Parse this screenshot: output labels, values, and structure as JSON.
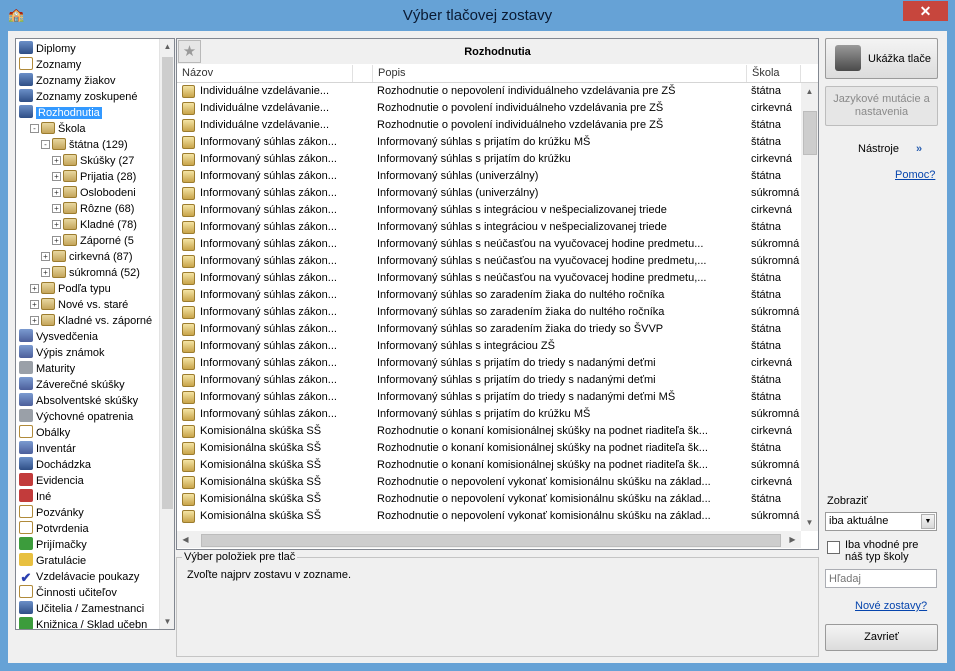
{
  "window": {
    "title": "Výber tlačovej zostavy",
    "close_glyph": "✕"
  },
  "tree": {
    "items": [
      {
        "label": "Diplomy",
        "indent": 0,
        "icon": "user"
      },
      {
        "label": "Zoznamy",
        "indent": 0,
        "icon": "doc"
      },
      {
        "label": "Zoznamy žiakov",
        "indent": 0,
        "icon": "user"
      },
      {
        "label": "Zoznamy zoskupené",
        "indent": 0,
        "icon": "user"
      },
      {
        "label": "Rozhodnutia",
        "indent": 0,
        "icon": "user",
        "selected": true
      },
      {
        "label": "Škola",
        "indent": 1,
        "icon": "folder",
        "pm": "-"
      },
      {
        "label": "štátna (129)",
        "indent": 2,
        "icon": "folder",
        "pm": "-"
      },
      {
        "label": "Skúšky (27",
        "indent": 3,
        "icon": "folder",
        "pm": "+"
      },
      {
        "label": "Prijatia (28)",
        "indent": 3,
        "icon": "folder",
        "pm": "+"
      },
      {
        "label": "Oslobodeni",
        "indent": 3,
        "icon": "folder",
        "pm": "+"
      },
      {
        "label": "Rôzne (68)",
        "indent": 3,
        "icon": "folder",
        "pm": "+"
      },
      {
        "label": "Kladné (78)",
        "indent": 3,
        "icon": "folder",
        "pm": "+"
      },
      {
        "label": "Záporné (5",
        "indent": 3,
        "icon": "folder",
        "pm": "+"
      },
      {
        "label": "cirkevná (87)",
        "indent": 2,
        "icon": "folder",
        "pm": "+"
      },
      {
        "label": "súkromná (52)",
        "indent": 2,
        "icon": "folder",
        "pm": "+"
      },
      {
        "label": "Podľa typu",
        "indent": 1,
        "icon": "folder",
        "pm": "+"
      },
      {
        "label": "Nové vs. staré",
        "indent": 1,
        "icon": "folder",
        "pm": "+"
      },
      {
        "label": "Kladné vs. záporné",
        "indent": 1,
        "icon": "folder",
        "pm": "+"
      },
      {
        "label": "Vysvedčenia",
        "indent": 0,
        "icon": "book"
      },
      {
        "label": "Výpis známok",
        "indent": 0,
        "icon": "book"
      },
      {
        "label": "Maturity",
        "indent": 0,
        "icon": "gray"
      },
      {
        "label": "Záverečné skúšky",
        "indent": 0,
        "icon": "book"
      },
      {
        "label": "Absolventské skúšky",
        "indent": 0,
        "icon": "book"
      },
      {
        "label": "Výchovné opatrenia",
        "indent": 0,
        "icon": "gray"
      },
      {
        "label": "Obálky",
        "indent": 0,
        "icon": "doc"
      },
      {
        "label": "Inventár",
        "indent": 0,
        "icon": "book"
      },
      {
        "label": "Dochádzka",
        "indent": 0,
        "icon": "user"
      },
      {
        "label": "Evidencia",
        "indent": 0,
        "icon": "red"
      },
      {
        "label": "Iné",
        "indent": 0,
        "icon": "red"
      },
      {
        "label": "Pozvánky",
        "indent": 0,
        "icon": "doc"
      },
      {
        "label": "Potvrdenia",
        "indent": 0,
        "icon": "doc"
      },
      {
        "label": "Prijímačky",
        "indent": 0,
        "icon": "grn"
      },
      {
        "label": "Gratulácie",
        "indent": 0,
        "icon": "yel"
      },
      {
        "label": "Vzdelávacie poukazy",
        "indent": 0,
        "icon": "check"
      },
      {
        "label": "Činnosti učiteľov",
        "indent": 0,
        "icon": "doc"
      },
      {
        "label": "Učitelia / Zamestnanci",
        "indent": 0,
        "icon": "user"
      },
      {
        "label": "Knižnica / Sklad učebn",
        "indent": 0,
        "icon": "grn"
      }
    ]
  },
  "main": {
    "title": "Rozhodnutia",
    "columns": [
      "Názov",
      "Popis",
      "Škola"
    ],
    "rows": [
      [
        "Individuálne vzdelávanie...",
        "Rozhodnutie o nepovolení individuálneho vzdelávania pre ZŠ",
        "štátna"
      ],
      [
        "Individuálne vzdelávanie...",
        "Rozhodnutie o povolení individuálneho vzdelávania pre ZŠ",
        "cirkevná"
      ],
      [
        "Individuálne vzdelávanie...",
        "Rozhodnutie o povolení individuálneho vzdelávania pre ZŠ",
        "štátna"
      ],
      [
        "Informovaný súhlas zákon...",
        "Informovaný súhlas s prijatím do krúžku MŠ",
        "štátna"
      ],
      [
        "Informovaný súhlas zákon...",
        "Informovaný súhlas s prijatím do krúžku",
        "cirkevná"
      ],
      [
        "Informovaný súhlas zákon...",
        "Informovaný súhlas (univerzálny)",
        "štátna"
      ],
      [
        "Informovaný súhlas zákon...",
        "Informovaný súhlas (univerzálny)",
        "súkromná"
      ],
      [
        "Informovaný súhlas zákon...",
        "Informovaný súhlas s integráciou v nešpecializovanej triede",
        "cirkevná"
      ],
      [
        "Informovaný súhlas zákon...",
        "Informovaný súhlas s integráciou v nešpecializovanej triede",
        "štátna"
      ],
      [
        "Informovaný súhlas zákon...",
        "Informovaný súhlas s neúčasťou na vyučovacej hodine predmetu...",
        "súkromná"
      ],
      [
        "Informovaný súhlas zákon...",
        "Informovaný súhlas s neúčasťou na vyučovacej hodine predmetu,...",
        "súkromná"
      ],
      [
        "Informovaný súhlas zákon...",
        "Informovaný súhlas s neúčasťou na vyučovacej hodine predmetu,...",
        "štátna"
      ],
      [
        "Informovaný súhlas zákon...",
        "Informovaný súhlas so zaradením žiaka do nultého ročníka",
        "štátna"
      ],
      [
        "Informovaný súhlas zákon...",
        "Informovaný súhlas so zaradením žiaka do nultého ročníka",
        "súkromná"
      ],
      [
        "Informovaný súhlas zákon...",
        "Informovaný súhlas so zaradením žiaka do triedy so ŠVVP",
        "štátna"
      ],
      [
        "Informovaný súhlas zákon...",
        "Informovaný súhlas s integráciou ZŠ",
        "štátna"
      ],
      [
        "Informovaný súhlas zákon...",
        "Informovaný súhlas s prijatím do triedy s nadanými deťmi",
        "cirkevná"
      ],
      [
        "Informovaný súhlas zákon...",
        "Informovaný súhlas s prijatím do triedy s nadanými deťmi",
        "štátna"
      ],
      [
        "Informovaný súhlas zákon...",
        "Informovaný súhlas s prijatím do triedy s nadanými deťmi MŠ",
        "štátna"
      ],
      [
        "Informovaný súhlas zákon...",
        "Informovaný súhlas s prijatím do krúžku MŠ",
        "súkromná"
      ],
      [
        "Komisionálna skúška SŠ",
        "Rozhodnutie o konaní komisionálnej skúšky na podnet riaditeľa šk...",
        "cirkevná"
      ],
      [
        "Komisionálna skúška SŠ",
        "Rozhodnutie o konaní komisionálnej skúšky na podnet riaditeľa šk...",
        "štátna"
      ],
      [
        "Komisionálna skúška SŠ",
        "Rozhodnutie o konaní komisionálnej skúšky na podnet riaditeľa šk...",
        "súkromná"
      ],
      [
        "Komisionálna skúška SŠ",
        "Rozhodnutie o nepovolení vykonať komisionálnu skúšku na základ...",
        "cirkevná"
      ],
      [
        "Komisionálna skúška SŠ",
        "Rozhodnutie o nepovolení vykonať komisionálnu skúšku na základ...",
        "štátna"
      ],
      [
        "Komisionálna skúška SŠ",
        "Rozhodnutie o nepovolení vykonať komisionálnu skúšku na základ...",
        "súkromná"
      ]
    ]
  },
  "selection_group": {
    "title": "Výber položiek pre tlač",
    "text": "Zvoľte najprv zostavu v zozname."
  },
  "side": {
    "preview_button": "Ukážka tlače",
    "lang_button": "Jazykové mutácie a nastavenia",
    "tools_label": "Nástroje",
    "tools_chevron": "»",
    "help_link": "Pomoc?",
    "show_label": "Zobraziť",
    "show_value": "iba aktuálne",
    "only_suitable_label": "Iba vhodné pre náš typ školy",
    "search_placeholder": "Hľadaj",
    "new_reports_link": "Nové zostavy?",
    "close_button": "Zavrieť"
  }
}
